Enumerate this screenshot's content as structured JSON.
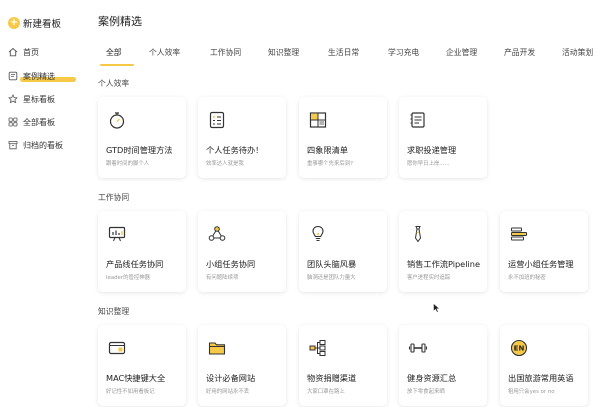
{
  "sidebar": {
    "new_board": "新建看板",
    "items": [
      {
        "label": "首页"
      },
      {
        "label": "案例精选"
      },
      {
        "label": "星标看板"
      },
      {
        "label": "全部看板"
      },
      {
        "label": "归档的看板"
      }
    ]
  },
  "main": {
    "title": "案例精选",
    "tabs": [
      "全部",
      "个人效率",
      "工作协同",
      "知识整理",
      "生活日常",
      "学习充电",
      "企业管理",
      "产品开发",
      "活动策划"
    ],
    "sections": [
      {
        "title": "个人效率",
        "cards": [
          {
            "title": "GTD时间管理方法",
            "subtitle": "跟着时间的脚个人"
          },
          {
            "title": "个人任务待办！",
            "subtitle": "效率达人就是我"
          },
          {
            "title": "四象限清单",
            "subtitle": "重事哪个先来后到?"
          },
          {
            "title": "求职投递管理",
            "subtitle": "愿你早日上岸......"
          }
        ]
      },
      {
        "title": "工作协同",
        "cards": [
          {
            "title": "产品线任务协同",
            "subtitle": "leader的管控神器"
          },
          {
            "title": "小组任务协同",
            "subtitle": "有问题陆续项"
          },
          {
            "title": "团队头脑风暴",
            "subtitle": "脑洞还是团队力量大"
          },
          {
            "title": "销售工作流Pipeline",
            "subtitle": "客户进程实时追踪"
          },
          {
            "title": "运营小组任务管理",
            "subtitle": "永不加班的秘密"
          }
        ]
      },
      {
        "title": "知识整理",
        "cards": [
          {
            "title": "MAC快捷键大全",
            "subtitle": "好记性不如用看板记"
          },
          {
            "title": "设计必备网站",
            "subtitle": "好用的网站永不丢"
          },
          {
            "title": "物资捐赠渠道",
            "subtitle": "大家口罩在路上"
          },
          {
            "title": "健身资源汇总",
            "subtitle": "放下零食起来晒"
          },
          {
            "title": "出国旅游常用英语",
            "subtitle": "租用只会yes or no"
          }
        ]
      }
    ]
  },
  "colors": {
    "accent": "#f7c948"
  }
}
